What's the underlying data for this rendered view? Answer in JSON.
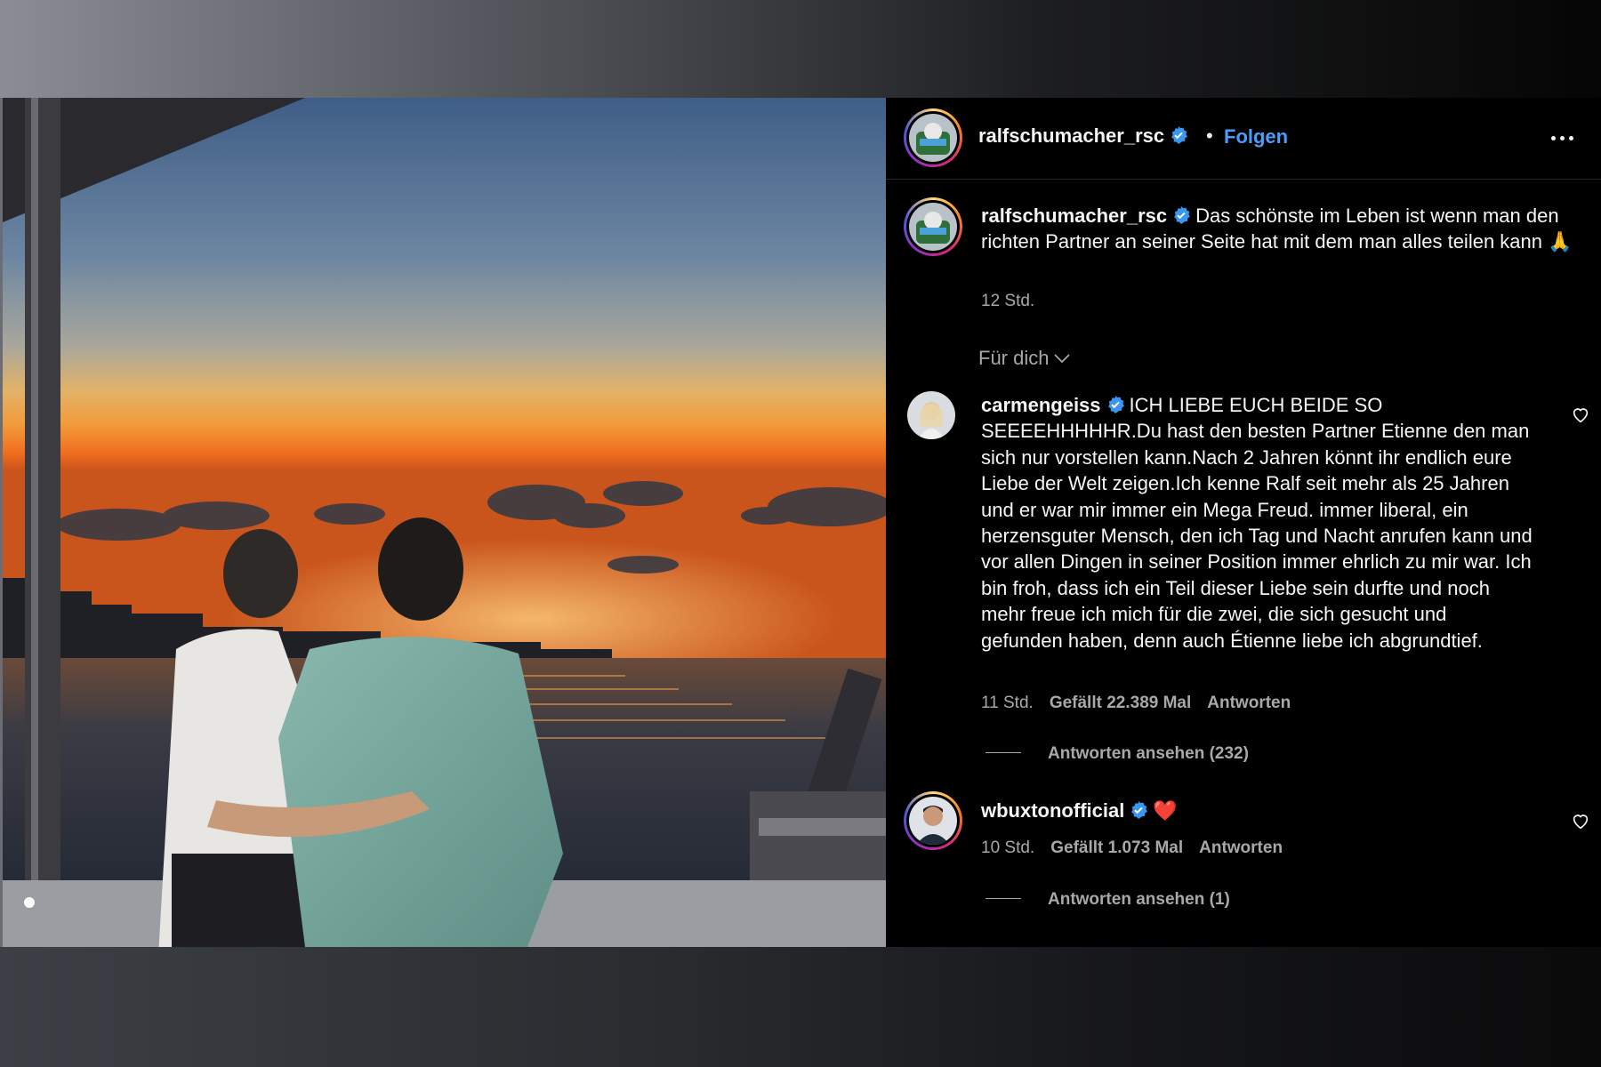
{
  "post": {
    "username": "ralfschumacher_rsc",
    "follow_label": "Folgen",
    "separator": "•",
    "caption": "Das schönste im Leben ist wenn man den richten Partner an seiner Seite hat mit dem man alles teilen kann 🙏",
    "caption_time": "12 Std.",
    "sort_label": "Für dich"
  },
  "comments": [
    {
      "username": "carmengeiss",
      "text": "ICH LIEBE EUCH BEIDE SO SEEEEHHHHHR.Du hast den besten Partner Etienne den man sich nur vorstellen kann.Nach 2 Jahren könnt ihr endlich eure Liebe der Welt zeigen.Ich kenne Ralf seit mehr als 25 Jahren und er war mir immer ein Mega Freud. immer liberal, ein herzensguter Mensch, den ich Tag und Nacht anrufen kann und vor allen Dingen in seiner Position immer ehrlich zu mir war. Ich bin froh, dass ich ein Teil dieser Liebe sein durfte und noch mehr freue ich mich für die zwei, die sich gesucht und gefunden haben, denn auch Étienne liebe ich abgrundtief.",
      "time": "11 Std.",
      "likes": "Gefällt 22.389 Mal",
      "reply_label": "Antworten",
      "view_replies": "Antworten ansehen (232)"
    },
    {
      "username": "wbuxtonofficial",
      "text": "❤️",
      "time": "10 Std.",
      "likes": "Gefällt 1.073 Mal",
      "reply_label": "Antworten",
      "view_replies": "Antworten ansehen (1)"
    }
  ],
  "icons": {
    "more": "more-icon",
    "verified": "verified-badge-icon",
    "heart": "heart-outline-icon",
    "chevron": "chevron-down-icon"
  },
  "colors": {
    "panel_bg": "#000000",
    "link_blue": "#4a9df8",
    "verified_blue": "#3897f0",
    "secondary_text": "#a8a8a8"
  }
}
